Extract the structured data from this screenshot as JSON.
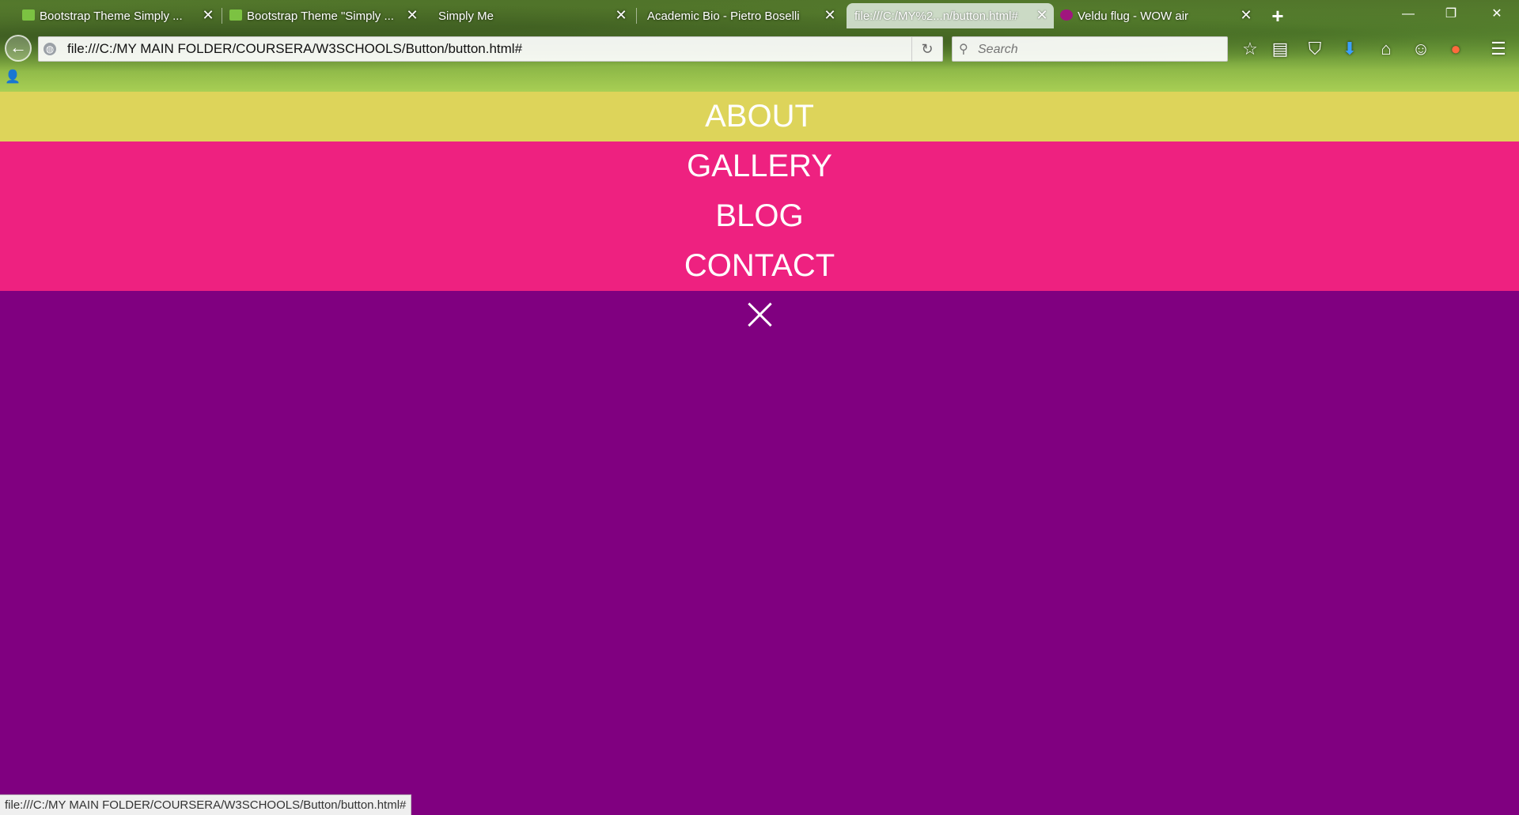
{
  "browser": {
    "tabs": [
      {
        "label": "Bootstrap Theme Simply ...",
        "favicon": "w3-icon",
        "active": false
      },
      {
        "label": "Bootstrap Theme \"Simply ...",
        "favicon": "w3-icon",
        "active": false
      },
      {
        "label": "Simply Me",
        "favicon": "none",
        "active": false
      },
      {
        "label": "Academic Bio - Pietro Boselli",
        "favicon": "none",
        "active": false
      },
      {
        "label": "file:///C:/MY%2...n/button.html#",
        "favicon": "none",
        "active": true
      },
      {
        "label": "Veldu flug - WOW air",
        "favicon": "wow-icon",
        "active": false
      }
    ],
    "new_tab_label": "+",
    "url": "file:///C:/MY MAIN FOLDER/COURSERA/W3SCHOOLS/Button/button.html#",
    "search_placeholder": "Search",
    "status_url": "file:///C:/MY MAIN FOLDER/COURSERA/W3SCHOOLS/Button/button.html#"
  },
  "page": {
    "nav_items": {
      "about": "ABOUT",
      "gallery": "GALLERY",
      "blog": "BLOG",
      "contact": "CONTACT"
    },
    "colors": {
      "about_bg": "#ddd45a",
      "links_bg": "#ee2180",
      "page_bg": "#800080"
    }
  }
}
